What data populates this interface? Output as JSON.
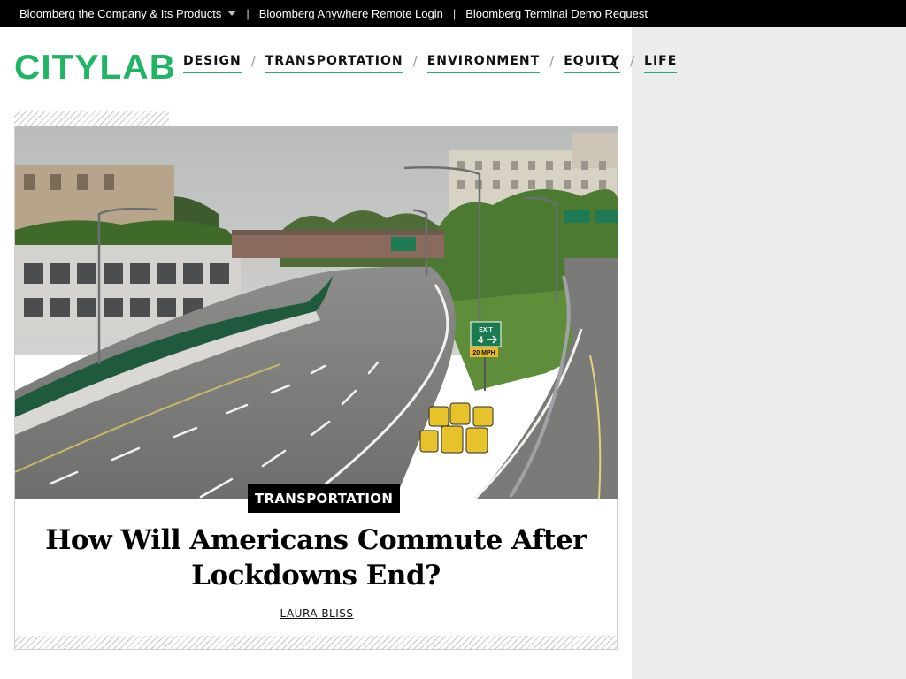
{
  "topbar": {
    "company_products": "Bloomberg the Company & Its Products",
    "anywhere_login": "Bloomberg Anywhere Remote Login",
    "terminal_demo": "Bloomberg Terminal Demo Request",
    "separator": "|"
  },
  "header": {
    "logo": "CITYLAB",
    "nav": [
      {
        "label": "DESIGN"
      },
      {
        "label": "TRANSPORTATION"
      },
      {
        "label": "ENVIRONMENT"
      },
      {
        "label": "EQUITY"
      },
      {
        "label": "LIFE"
      }
    ],
    "nav_separator": "/"
  },
  "article": {
    "tag": "TRANSPORTATION",
    "headline": "How Will Americans Commute After Lockdowns End?",
    "author": "LAURA BLISS",
    "sign_exit": "EXIT",
    "sign_exit_number": "4",
    "sign_speed": "20 MPH"
  },
  "colors": {
    "accent": "#1fb564",
    "topbar_bg": "#000000",
    "sidebar_bg": "#ececec"
  },
  "icons": {
    "search": "search-icon",
    "dropdown": "caret-down-icon"
  }
}
